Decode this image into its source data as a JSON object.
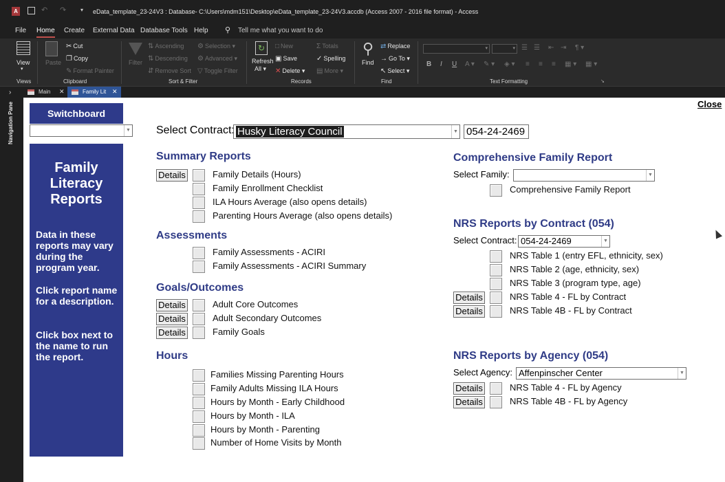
{
  "titlebar": {
    "title": "eData_template_23-24V3 : Database- C:\\Users\\mdm151\\Desktop\\eData_template_23-24V3.accdb (Access 2007 - 2016 file format)  -  Access",
    "app_icon": "access-logo",
    "qat_icons": [
      "save-icon",
      "undo-icon",
      "redo-icon",
      "customize-qat-icon"
    ]
  },
  "menu": {
    "items": [
      "File",
      "Home",
      "Create",
      "External Data",
      "Database Tools",
      "Help"
    ],
    "tell_me": "Tell me what you want to do",
    "active": "Home"
  },
  "ribbon": {
    "views": {
      "view": "View",
      "group": "Views"
    },
    "clipboard": {
      "paste": "Paste",
      "cut": "Cut",
      "copy": "Copy",
      "format_painter": "Format Painter",
      "group": "Clipboard"
    },
    "sort_filter": {
      "filter": "Filter",
      "ascending": "Ascending",
      "descending": "Descending",
      "remove_sort": "Remove Sort",
      "selection": "Selection",
      "advanced": "Advanced",
      "toggle_filter": "Toggle Filter",
      "group": "Sort & Filter"
    },
    "records": {
      "refresh_all": "Refresh",
      "refresh_all2": "All",
      "new": "New",
      "save": "Save",
      "delete": "Delete",
      "totals": "Totals",
      "spelling": "Spelling",
      "more": "More",
      "group": "Records"
    },
    "find": {
      "find": "Find",
      "replace": "Replace",
      "goto": "Go To",
      "select": "Select",
      "group": "Find"
    },
    "text_formatting": {
      "bold": "B",
      "italic": "I",
      "underline": "U",
      "group": "Text Formatting"
    }
  },
  "navigation": {
    "label": "Navigation Pane"
  },
  "tabs": [
    {
      "label": "Main"
    },
    {
      "label": "Family Lit"
    }
  ],
  "form": {
    "close": "Close",
    "switchboard": "Switchboard",
    "side_title": "Family Literacy Reports",
    "side_text_1": "Data in these reports may vary during the program year.",
    "side_text_2": "Click report name for a description.",
    "side_text_3": "Click box next to the name to run the report.",
    "select_contract_label": "Select Contract:",
    "select_contract_value": "Husky Literacy Council",
    "contract_code": "054-24-2469",
    "details_label": "Details",
    "summary": {
      "heading": "Summary Reports",
      "items": [
        "Family Details (Hours)",
        "Family Enrollment Checklist",
        "ILA Hours Average (also opens details)",
        "Parenting Hours Average (also opens details)"
      ]
    },
    "assessments": {
      "heading": "Assessments",
      "items": [
        "Family Assessments - ACIRI",
        "Family Assessments - ACIRI Summary"
      ]
    },
    "goals": {
      "heading": "Goals/Outcomes",
      "items": [
        "Adult Core Outcomes",
        "Adult Secondary Outcomes",
        "Family Goals"
      ]
    },
    "hours": {
      "heading": "Hours",
      "items": [
        "Families Missing Parenting Hours",
        "Family Adults Missing ILA Hours",
        "Hours by Month - Early Childhood",
        "Hours by Month - ILA",
        "Hours by Month - Parenting",
        "Number of Home Visits by Month"
      ]
    },
    "comprehensive": {
      "heading": "Comprehensive Family Report",
      "select_family_label": "Select Family:",
      "select_family_value": "",
      "item": "Comprehensive Family Report"
    },
    "nrs_contract": {
      "heading": "NRS Reports by Contract (054)",
      "select_label": "Select Contract:",
      "select_value": "054-24-2469",
      "items": [
        "NRS Table 1 (entry EFL, ethnicity, sex)",
        "NRS Table 2 (age, ethnicity, sex)",
        "NRS Table 3 (program type, age)",
        "NRS Table 4 - FL by Contract",
        "NRS Table 4B - FL by Contract"
      ]
    },
    "nrs_agency": {
      "heading": "NRS Reports by Agency (054)",
      "select_label": "Select Agency:",
      "select_value": "Affenpinscher Center",
      "items": [
        "NRS Table 4 - FL by Agency",
        "NRS Table 4B - FL by Agency"
      ]
    }
  }
}
